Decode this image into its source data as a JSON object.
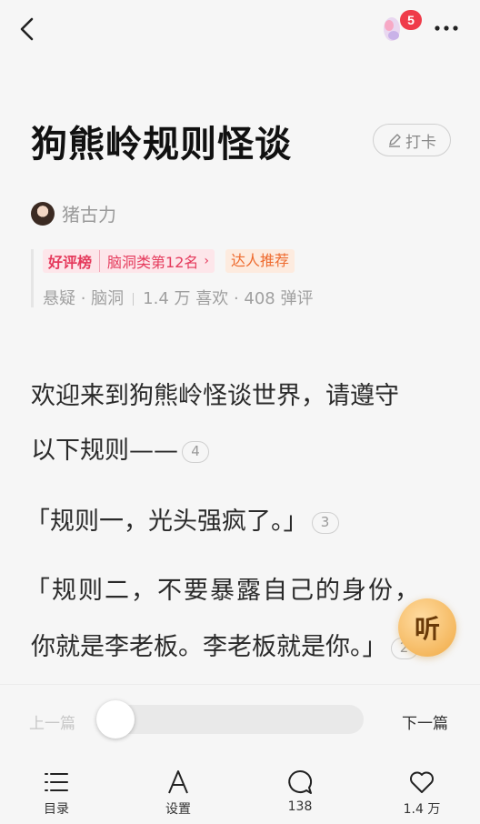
{
  "header": {
    "gift_badge": "5"
  },
  "book": {
    "title": "狗熊岭规则怪谈",
    "checkin_label": "打卡",
    "author": "猪古力",
    "rank_tag_lead": "好评榜",
    "rank_tag_text": "脑洞类第12名",
    "expert_tag": "达人推荐",
    "genre": "悬疑 · 脑洞",
    "likes": "1.4 万 喜欢 · 408 弹评"
  },
  "content": {
    "p1": "欢迎来到狗熊岭怪谈世界，请遵守",
    "p2": "以下规则——",
    "p2_count": "4",
    "p3": "「规则一，光头强疯了。」",
    "p3_count": "3",
    "p4": "「规则二，不要暴露自己的身份，",
    "p5": "你就是李老板。李老板就是你。」",
    "p5_count": "2"
  },
  "listen_label": "听",
  "reader_bar": {
    "prev_label": "上一篇",
    "next_label": "下一篇",
    "progress": 0.0
  },
  "tabs": [
    {
      "label": "目录",
      "icon": "list-icon"
    },
    {
      "label": "设置",
      "icon": "font-icon"
    },
    {
      "label": "138",
      "icon": "comment-icon"
    },
    {
      "label": "1.4 万",
      "icon": "heart-icon"
    }
  ],
  "colors": {
    "accent_red": "#e53a5c",
    "badge_red": "#ef3b4a",
    "expert_orange": "#ee6b2f",
    "listen_gold": "#f4b65b"
  }
}
